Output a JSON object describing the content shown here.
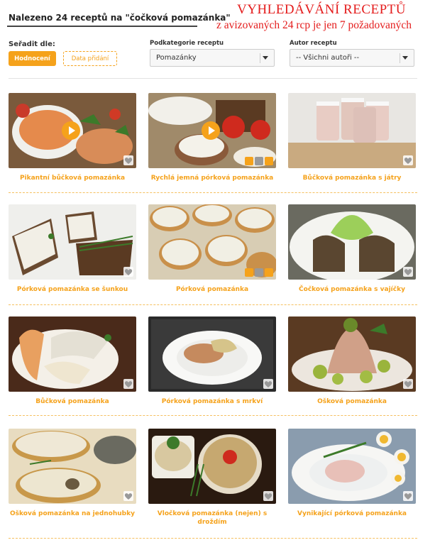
{
  "header": {
    "title": "Nalezeno 24 receptů na \"čočková pomazánka\""
  },
  "annotation": {
    "line1": "VYHLEDÁVÁNÍ  RECEPTŮ",
    "line2": "z avizovaných 24 rcp je jen 7 požadovaných"
  },
  "sort": {
    "label": "Seřadit dle:",
    "active_label": "Hodnocení",
    "secondary_label": "Data přidání"
  },
  "filters": {
    "subcategory_label": "Podkategorie receptu",
    "subcategory_value": "Pomazánky",
    "author_label": "Autor receptu",
    "author_value": "-- Všichni autoři --"
  },
  "recipes": [
    {
      "title": "Pikantní bůčková pomazánka",
      "icon": "heart-icon",
      "video": true
    },
    {
      "title": "Rychlá jemná pórková pomazánka",
      "icon": "heart-icon",
      "video": true
    },
    {
      "title": "Bůčková pomazánka s játry",
      "icon": "heart-icon"
    },
    {
      "title": "Pórková pomazánka se šunkou",
      "icon": "heart-icon"
    },
    {
      "title": "Pórková pomazánka",
      "icon": "heart-icon"
    },
    {
      "title": "Čočková pomazánka s vajíčky",
      "icon": "heart-icon"
    },
    {
      "title": "Bůčková pomazánka",
      "icon": "heart-icon"
    },
    {
      "title": "Pórková pomazánka s mrkví",
      "icon": "heart-icon"
    },
    {
      "title": "Ošková pomazánka",
      "icon": "heart-icon"
    },
    {
      "title": "Ošková pomazánka na jednohubky",
      "icon": "heart-icon"
    },
    {
      "title": "Vločková pomazánka (nejen) s droždím",
      "icon": "heart-icon"
    },
    {
      "title": "Vynikající pórková pomazánka",
      "icon": "heart-icon"
    }
  ],
  "colors": {
    "accent": "#f5a21b",
    "annotation": "#e41c1c"
  }
}
